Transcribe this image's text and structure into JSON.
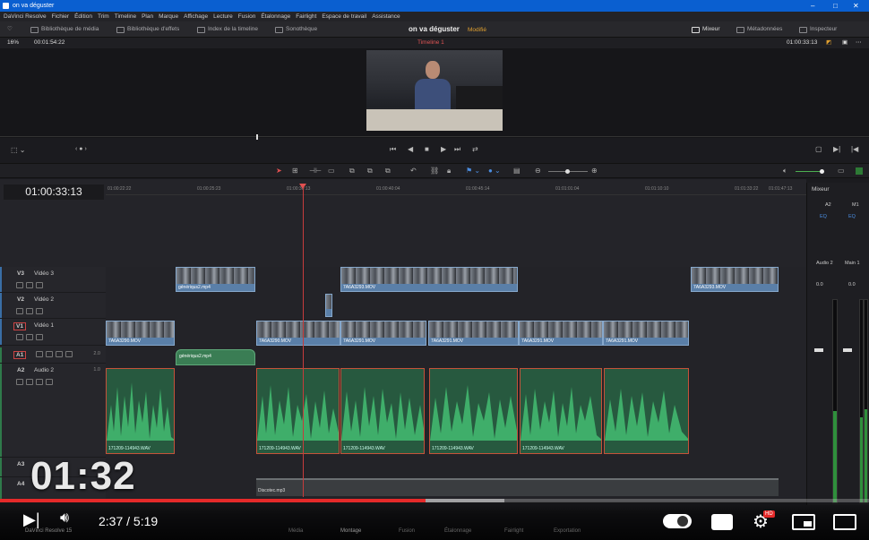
{
  "window": {
    "title": "on va déguster",
    "minimize": "–",
    "maximize": "□",
    "close": "✕"
  },
  "menu": [
    "DaVinci Resolve",
    "Fichier",
    "Édition",
    "Trim",
    "Timeline",
    "Plan",
    "Marque",
    "Affichage",
    "Lecture",
    "Fusion",
    "Étalonnage",
    "Fairlight",
    "Espace de travail",
    "Assistance"
  ],
  "toolbar": {
    "media_pool": "Bibliothèque de média",
    "effects": "Bibliothèque d'effets",
    "timeline_index": "Index de la timeline",
    "sound_library": "Sonothèque",
    "project_name": "on va déguster",
    "project_state": "Modifié",
    "mixer": "Mixeur",
    "metadata": "Métadonnées",
    "inspector": "Inspecteur"
  },
  "viewer": {
    "zoom": "16%",
    "source_tc": "00:01:54:22",
    "timeline_name": "Timeline 1",
    "record_tc": "01:00:33:13"
  },
  "timeline": {
    "timecode": "01:00:33:13",
    "ruler": [
      "01:00:22:22",
      "01:00:25:23",
      "01:00:30:13",
      "01:00:40:04",
      "01:00:45:14",
      "01:01:01:04",
      "01:01:10:10",
      "01:01:33:22",
      "01:01:47:13"
    ],
    "tracks": [
      {
        "id": "V3",
        "name": "Vidéo 3",
        "color": "#3a6ea5"
      },
      {
        "id": "V2",
        "name": "Vidéo 2",
        "color": "#3a6ea5"
      },
      {
        "id": "V1",
        "name": "Vidéo 1",
        "color": "#3a6ea5"
      },
      {
        "id": "A1",
        "name": "",
        "num": "2.0",
        "color": "#2f7a4a"
      },
      {
        "id": "A2",
        "name": "Audio 2",
        "num": "1.0",
        "color": "#2f7a4a"
      },
      {
        "id": "A3",
        "name": "",
        "num": "",
        "color": "#2f7a4a"
      },
      {
        "id": "A4",
        "name": "",
        "num": "",
        "color": "#2f7a4a"
      }
    ],
    "clips": {
      "v3": [
        "génériqus2.mp4",
        "7A6A3293.MOV",
        "7A6A3293.MOV"
      ],
      "v1": [
        "7A6A3290.MOV",
        "7A6A3290.MOV",
        "7A6A3291.MOV",
        "7A6A3291.MOV",
        "7A6A3291.MOV",
        "7A6A3291.MOV"
      ],
      "a1": "génériqus2.mp4",
      "a2": [
        "171209-114943.WAV",
        "171209-114943.WAV",
        "171209-114943.WAV",
        "171209-114943.WAV",
        "171209-114943.WAV"
      ],
      "a4": "Discotec.mp3"
    }
  },
  "mixer": {
    "title": "Mixeur",
    "col1": "A2",
    "col2": "M1",
    "col3": "Audio 2",
    "col4": "Main 1",
    "eq": "EQ",
    "val1": "0.0",
    "val2": "0.0"
  },
  "overlay": {
    "big_time": "01:32"
  },
  "player": {
    "time": "2:37 / 5:19",
    "played_fraction": 0.49,
    "buffered_fraction": 0.58,
    "hd_badge": "HD"
  },
  "pages": [
    "Média",
    "Montage",
    "Fusion",
    "Étalonnage",
    "Fairlight",
    "Exportation"
  ],
  "resolve_version": "DaVinci Resolve 15"
}
